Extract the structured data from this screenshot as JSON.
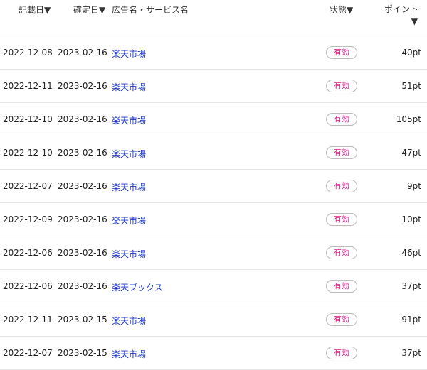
{
  "header": {
    "recorded_date": "記載日▼",
    "confirmed_date": "確定日▼",
    "ad_name": "広告名・サービス名",
    "status": "状態▼",
    "points": "ポイント",
    "points_arrow": "▼"
  },
  "rows": [
    {
      "recorded": "2022-12-08",
      "confirmed": "2023-02-16",
      "ad": "楽天市場",
      "status": "有効",
      "points": "40pt"
    },
    {
      "recorded": "2022-12-11",
      "confirmed": "2023-02-16",
      "ad": "楽天市場",
      "status": "有効",
      "points": "51pt"
    },
    {
      "recorded": "2022-12-10",
      "confirmed": "2023-02-16",
      "ad": "楽天市場",
      "status": "有効",
      "points": "105pt"
    },
    {
      "recorded": "2022-12-10",
      "confirmed": "2023-02-16",
      "ad": "楽天市場",
      "status": "有効",
      "points": "47pt"
    },
    {
      "recorded": "2022-12-07",
      "confirmed": "2023-02-16",
      "ad": "楽天市場",
      "status": "有効",
      "points": "9pt"
    },
    {
      "recorded": "2022-12-09",
      "confirmed": "2023-02-16",
      "ad": "楽天市場",
      "status": "有効",
      "points": "10pt"
    },
    {
      "recorded": "2022-12-06",
      "confirmed": "2023-02-16",
      "ad": "楽天市場",
      "status": "有効",
      "points": "46pt"
    },
    {
      "recorded": "2022-12-06",
      "confirmed": "2023-02-16",
      "ad": "楽天ブックス",
      "status": "有効",
      "points": "37pt"
    },
    {
      "recorded": "2022-12-11",
      "confirmed": "2023-02-15",
      "ad": "楽天市場",
      "status": "有効",
      "points": "91pt"
    },
    {
      "recorded": "2022-12-07",
      "confirmed": "2023-02-15",
      "ad": "楽天市場",
      "status": "有効",
      "points": "37pt"
    }
  ]
}
